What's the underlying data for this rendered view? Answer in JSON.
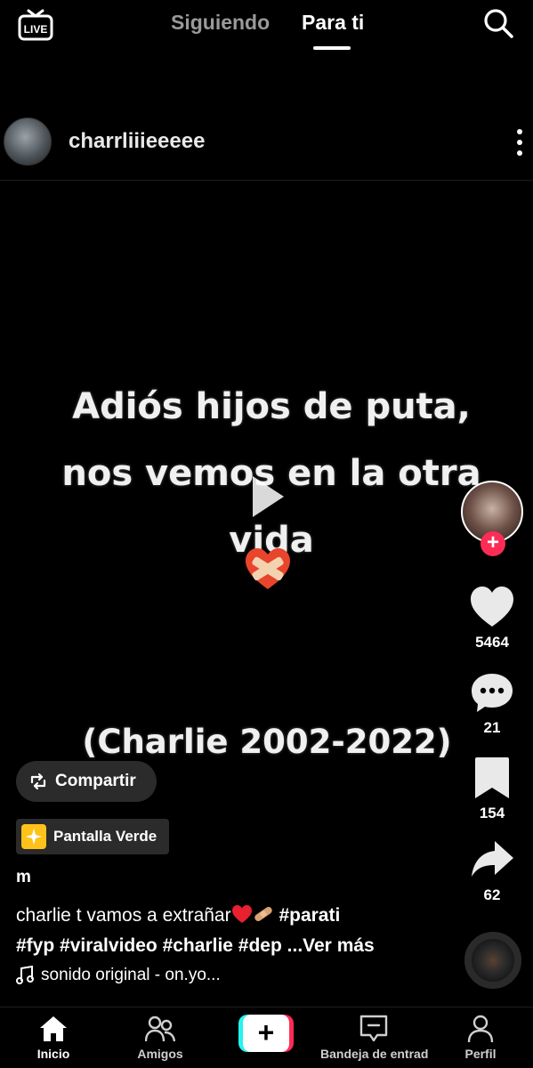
{
  "top_tabs": {
    "live_label": "LIVE",
    "following": "Siguiendo",
    "for_you": "Para ti"
  },
  "post": {
    "author": "charrliiieeeee",
    "video_text": "Adiós hijos de puta, nos vemos en la otra vida",
    "video_subtext": "(Charlie 2002-2022)",
    "share_button": "Compartir",
    "effect": "Pantalla Verde",
    "username": "m",
    "caption_text": "charlie t vamos a extrañar",
    "hashtags_line1": "#parati",
    "hashtags_line2": "#fyp #viralvideo  #charlie #dep",
    "see_more": "...Ver más",
    "sound": "sonido original - on.yo..."
  },
  "actions": {
    "likes": "5464",
    "comments": "21",
    "saves": "154",
    "shares": "62"
  },
  "bottom_nav": {
    "home": "Inicio",
    "friends": "Amigos",
    "create": "+",
    "inbox": "Bandeja de entrad",
    "profile": "Perfil"
  },
  "colors": {
    "background": "#000000",
    "accent_pink": "#fe2c55",
    "accent_cyan": "#25f4ee",
    "pill_bg": "#2b2b2b",
    "effect_yellow": "#ffc21a"
  }
}
